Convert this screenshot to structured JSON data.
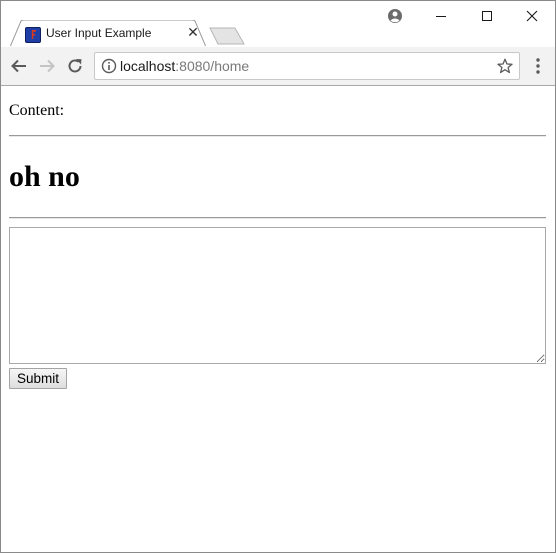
{
  "browser": {
    "tab": {
      "title": "User Input Example",
      "favicon": "app-logo-icon"
    },
    "close_tab_glyph": "✕",
    "address": {
      "host": "localhost",
      "rest": ":8080/home"
    },
    "icons": [
      "back-icon",
      "forward-icon",
      "reload-icon",
      "info-icon",
      "star-icon",
      "menu-icon",
      "profile-icon",
      "minimize-icon",
      "maximize-icon",
      "close-icon"
    ]
  },
  "page": {
    "label": "Content:",
    "heading": "oh no",
    "textarea_value": "",
    "submit_label": "Submit"
  }
}
